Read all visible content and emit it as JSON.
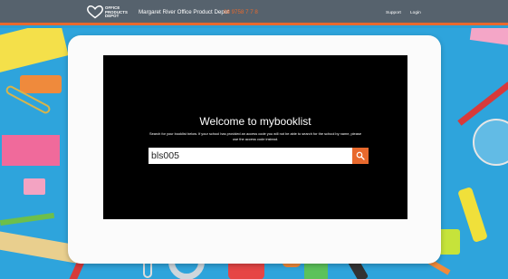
{
  "header": {
    "logo_lines": [
      "OFFICE",
      "PRODUCTS",
      "DEPOT"
    ],
    "store_name": "Margaret River Office Product Depot",
    "store_phone": "08 9758 7 7 8",
    "support_label": "Support",
    "login_label": "Login",
    "colors": {
      "bar": "#56626d",
      "accent": "#e8692d"
    }
  },
  "main": {
    "welcome_title": "Welcome to mybooklist",
    "help_text": "Search for your booklist below. If your school has provided an access code you will not be able to search for the school by name, please use the access code instead.",
    "search": {
      "value": "bls005",
      "placeholder": ""
    },
    "search_button_icon": "search-icon"
  }
}
